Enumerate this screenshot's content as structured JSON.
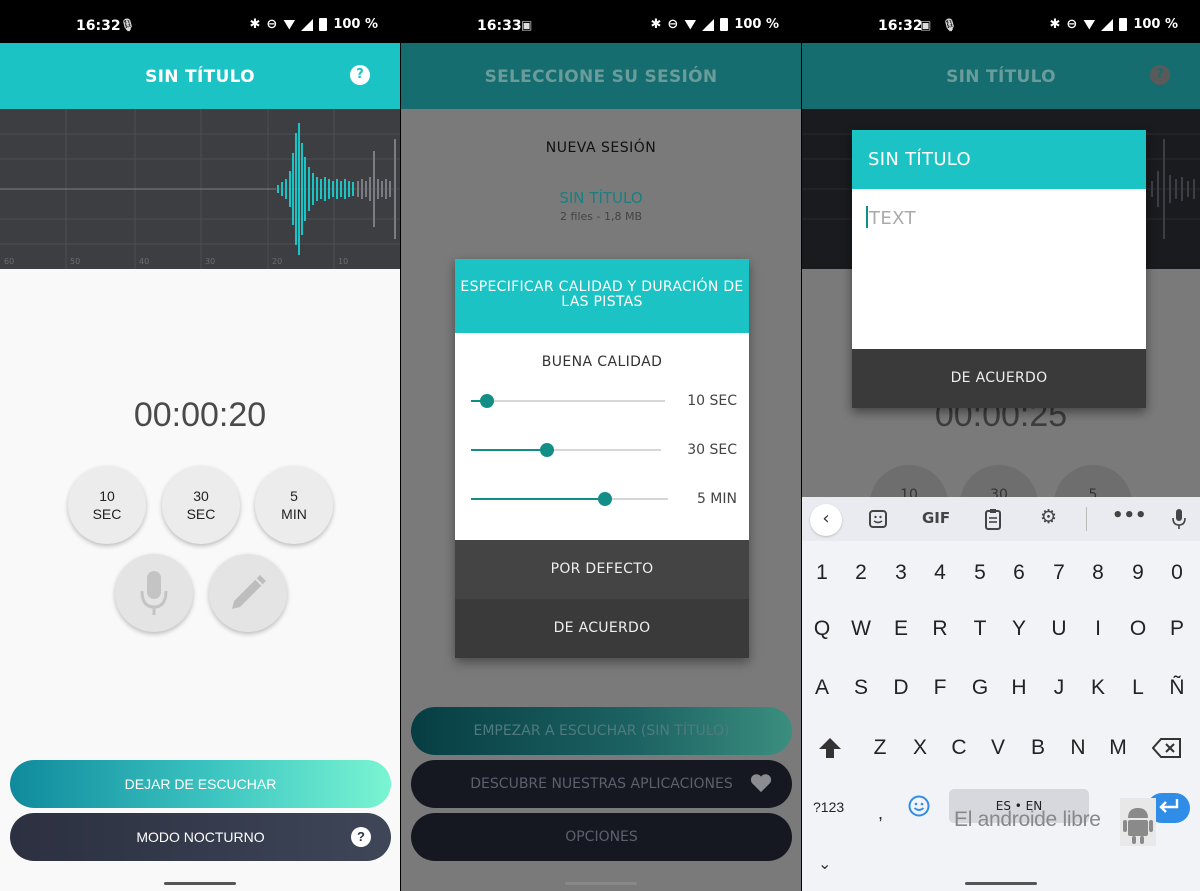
{
  "screen1": {
    "status": {
      "time": "16:32",
      "battery": "100 %"
    },
    "header": {
      "title": "SIN TÍTULO",
      "help": "?"
    },
    "timer": "00:00:20",
    "durations": [
      {
        "line1": "10",
        "line2": "SEC"
      },
      {
        "line1": "30",
        "line2": "SEC"
      },
      {
        "line1": "5",
        "line2": "MIN"
      }
    ],
    "waveform_ticks": [
      "60",
      "50",
      "40",
      "30",
      "20",
      "10"
    ],
    "buttons": {
      "stop": "DEJAR DE ESCUCHAR",
      "night": "MODO NOCTURNO",
      "night_help": "?"
    }
  },
  "screen2": {
    "status": {
      "time": "16:33",
      "battery": "100 %"
    },
    "header": {
      "title": "SELECCIONE SU SESIÓN"
    },
    "new_session": "NUEVA SESIÓN",
    "session": {
      "title": "SIN TÍTULO",
      "info": "2 files - 1,8 MB"
    },
    "dialog": {
      "title": "ESPECIFICAR CALIDAD Y DURACIÓN DE LAS PISTAS",
      "quality": "BUENA CALIDAD",
      "sliders": [
        {
          "label": "10 SEC",
          "value": 0.08
        },
        {
          "label": "30 SEC",
          "value": 0.4
        },
        {
          "label": "5 MIN",
          "value": 0.68
        }
      ],
      "default_btn": "POR DEFECTO",
      "ok_btn": "DE ACUERDO"
    },
    "buttons": {
      "listen": "EMPEZAR A ESCUCHAR (SIN TÍTULO)",
      "apps": "DESCUBRE NUESTRAS APLICACIONES",
      "options": "OPCIONES"
    }
  },
  "screen3": {
    "status": {
      "time": "16:32",
      "battery": "100 %"
    },
    "header": {
      "title": "SIN TÍTULO",
      "help": "?"
    },
    "timer": "00:00:25",
    "durations_partial": [
      "10",
      "30",
      "5"
    ],
    "dialog": {
      "title": "SIN TÍTULO",
      "placeholder": "TEXT",
      "ok_btn": "DE ACUERDO"
    },
    "keyboard": {
      "toolbar_gif": "GIF",
      "row_numbers": [
        "1",
        "2",
        "3",
        "4",
        "5",
        "6",
        "7",
        "8",
        "9",
        "0"
      ],
      "row_q": [
        "Q",
        "W",
        "E",
        "R",
        "T",
        "Y",
        "U",
        "I",
        "O",
        "P"
      ],
      "row_a": [
        "A",
        "S",
        "D",
        "F",
        "G",
        "H",
        "J",
        "K",
        "L",
        "Ñ"
      ],
      "row_z": [
        "Z",
        "X",
        "C",
        "V",
        "B",
        "N",
        "M"
      ],
      "symbols_key": "?123",
      "comma_key": ",",
      "space_label": "ES • EN"
    },
    "watermark": "El androide libre"
  },
  "colors": {
    "accent": "#1cc3c5",
    "accent_dark": "#156d6f",
    "slider": "#138e87",
    "enter_key": "#2f8de8"
  }
}
